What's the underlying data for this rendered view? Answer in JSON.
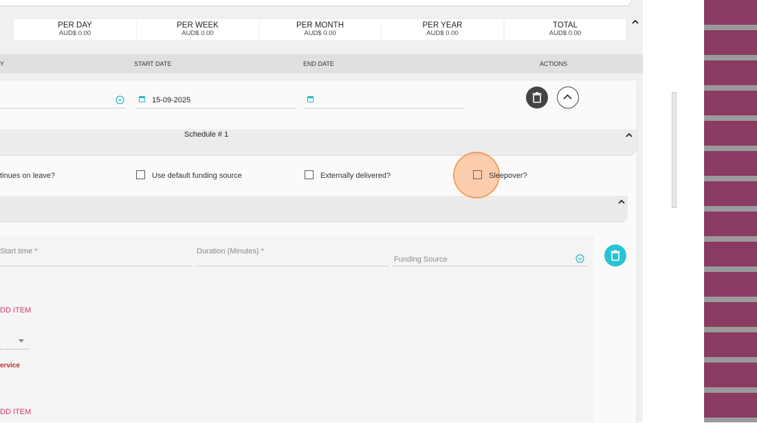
{
  "totals": [
    {
      "label": "PER DAY",
      "value": "AUD$ 0.00"
    },
    {
      "label": "PER WEEK",
      "value": "AUD$ 0.00"
    },
    {
      "label": "PER MONTH",
      "value": "AUD$ 0.00"
    },
    {
      "label": "PER YEAR",
      "value": "AUD$ 0.00"
    },
    {
      "label": "TOTAL",
      "value": "AUD$ 0.00"
    }
  ],
  "table_header": {
    "col_first_partial": "Y",
    "start_date": "START DATE",
    "end_date": "END DATE",
    "actions": "ACTIONS"
  },
  "row": {
    "start_date_value": "15-09-2025",
    "end_date_value": ""
  },
  "schedule": {
    "title": "Schedule # 1"
  },
  "options": {
    "continues_on_leave": "tinues on leave?",
    "use_default_funding": "Use default funding source",
    "externally_delivered": "Externally delivered?",
    "sleepover": "Sleepover?"
  },
  "item_fields": {
    "start_time_placeholder": "Start time *",
    "duration_placeholder": "Duration (Minutes) *",
    "funding_source_placeholder": "Funding Source"
  },
  "links": {
    "add_item_1": "DD ITEM",
    "add_item_2": "DD ITEM"
  },
  "error": {
    "service_partial": "ervice"
  },
  "colors": {
    "accent_teal": "#29b6c6",
    "pink_link": "#d6336c",
    "error_red": "#c62828",
    "dark_button": "#444444"
  }
}
